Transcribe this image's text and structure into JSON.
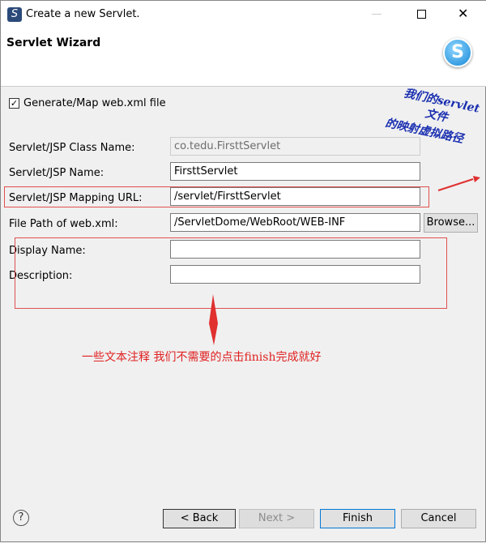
{
  "window": {
    "title": "Create a new Servlet."
  },
  "header": {
    "title": "Servlet Wizard"
  },
  "form": {
    "generate_checkbox_label": "Generate/Map web.xml file",
    "generate_checked": true,
    "class_name_label": "Servlet/JSP Class Name:",
    "class_name_value": "co.tedu.FirsttServlet",
    "name_label": "Servlet/JSP Name:",
    "name_value": "FirsttServlet",
    "mapping_label": "Servlet/JSP Mapping URL:",
    "mapping_value": "/servlet/FirsttServlet",
    "path_label": "File Path of web.xml:",
    "path_value": "/ServletDome/WebRoot/WEB-INF",
    "browse_label": "Browse...",
    "display_label": "Display Name:",
    "display_value": "",
    "description_label": "Description:",
    "description_value": ""
  },
  "annotations": {
    "line1": "我们的servlet",
    "line2": "文件",
    "line3": "的映射虚拟路径",
    "bottom": "一些文本注释 我们不需要的点击finish完成就好",
    "color": "#e02020"
  },
  "footer": {
    "back": "< Back",
    "next": "Next >",
    "finish": "Finish",
    "cancel": "Cancel"
  }
}
